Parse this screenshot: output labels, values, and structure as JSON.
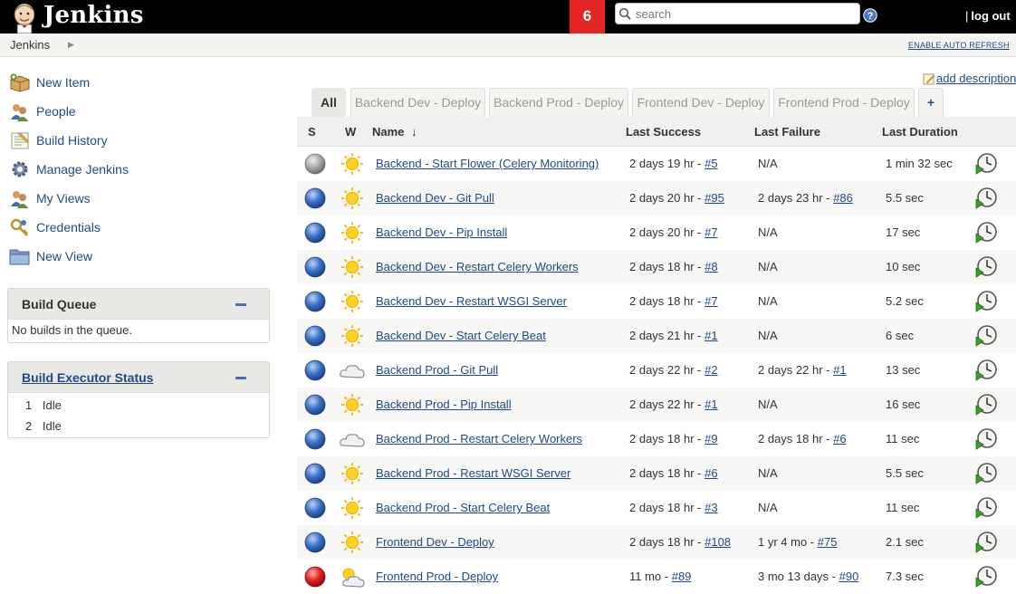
{
  "header": {
    "brand": "Jenkins",
    "notification_count": "6",
    "search_placeholder": "search",
    "logout_separator": "|",
    "logout_label": "log out"
  },
  "breadcrumb": {
    "home": "Jenkins",
    "auto_refresh": "ENABLE AUTO REFRESH"
  },
  "sidebar": {
    "tasks": [
      {
        "label": "New Item",
        "icon": "new-item-icon"
      },
      {
        "label": "People",
        "icon": "people-icon"
      },
      {
        "label": "Build History",
        "icon": "build-history-icon"
      },
      {
        "label": "Manage Jenkins",
        "icon": "gear-icon"
      },
      {
        "label": "My Views",
        "icon": "my-views-icon"
      },
      {
        "label": "Credentials",
        "icon": "credentials-icon"
      },
      {
        "label": "New View",
        "icon": "folder-icon"
      }
    ],
    "build_queue": {
      "title": "Build Queue",
      "empty_text": "No builds in the queue."
    },
    "executors": {
      "title": "Build Executor Status",
      "items": [
        {
          "num": "1",
          "status": "Idle"
        },
        {
          "num": "2",
          "status": "Idle"
        }
      ]
    }
  },
  "main": {
    "add_description": "add description",
    "tabs": [
      "All",
      "Backend Dev - Deploy",
      "Backend Prod - Deploy",
      "Frontend Dev - Deploy",
      "Frontend Prod - Deploy",
      "+"
    ],
    "columns": {
      "s": "S",
      "w": "W",
      "name": "Name",
      "sort_arrow": "↓",
      "last_success": "Last Success",
      "last_failure": "Last Failure",
      "last_duration": "Last Duration"
    },
    "jobs": [
      {
        "name": "Backend - Start Flower (Celery Monitoring)",
        "status": "grey",
        "weather": "sunny",
        "success_text": "2 days 19 hr - ",
        "success_build": "#5",
        "failure_text": "N/A",
        "failure_build": "",
        "duration": "1 min 32 sec"
      },
      {
        "name": "Backend Dev - Git Pull",
        "status": "blue",
        "weather": "sunny",
        "success_text": "2 days 20 hr - ",
        "success_build": "#95",
        "failure_text": "2 days 23 hr - ",
        "failure_build": "#86",
        "duration": "5.5 sec"
      },
      {
        "name": "Backend Dev - Pip Install",
        "status": "blue",
        "weather": "sunny",
        "success_text": "2 days 20 hr - ",
        "success_build": "#7",
        "failure_text": "N/A",
        "failure_build": "",
        "duration": "17 sec"
      },
      {
        "name": "Backend Dev - Restart Celery Workers",
        "status": "blue",
        "weather": "sunny",
        "success_text": "2 days 18 hr - ",
        "success_build": "#8",
        "failure_text": "N/A",
        "failure_build": "",
        "duration": "10 sec"
      },
      {
        "name": "Backend Dev - Restart WSGI Server",
        "status": "blue",
        "weather": "sunny",
        "success_text": "2 days 18 hr - ",
        "success_build": "#7",
        "failure_text": "N/A",
        "failure_build": "",
        "duration": "5.2 sec"
      },
      {
        "name": "Backend Dev - Start Celery Beat",
        "status": "blue",
        "weather": "sunny",
        "success_text": "2 days 21 hr - ",
        "success_build": "#1",
        "failure_text": "N/A",
        "failure_build": "",
        "duration": "6 sec"
      },
      {
        "name": "Backend Prod - Git Pull",
        "status": "blue",
        "weather": "cloudy",
        "success_text": "2 days 22 hr - ",
        "success_build": "#2",
        "failure_text": "2 days 22 hr - ",
        "failure_build": "#1",
        "duration": "13 sec"
      },
      {
        "name": "Backend Prod - Pip Install",
        "status": "blue",
        "weather": "sunny",
        "success_text": "2 days 22 hr - ",
        "success_build": "#1",
        "failure_text": "N/A",
        "failure_build": "",
        "duration": "16 sec"
      },
      {
        "name": "Backend Prod - Restart Celery Workers",
        "status": "blue",
        "weather": "cloudy",
        "success_text": "2 days 18 hr - ",
        "success_build": "#9",
        "failure_text": "2 days 18 hr - ",
        "failure_build": "#6",
        "duration": "11 sec"
      },
      {
        "name": "Backend Prod - Restart WSGI Server",
        "status": "blue",
        "weather": "sunny",
        "success_text": "2 days 18 hr - ",
        "success_build": "#6",
        "failure_text": "N/A",
        "failure_build": "",
        "duration": "5.5 sec"
      },
      {
        "name": "Backend Prod - Start Celery Beat",
        "status": "blue",
        "weather": "sunny",
        "success_text": "2 days 18 hr - ",
        "success_build": "#3",
        "failure_text": "N/A",
        "failure_build": "",
        "duration": "11 sec"
      },
      {
        "name": "Frontend Dev - Deploy",
        "status": "blue",
        "weather": "sunny",
        "success_text": "2 days 18 hr - ",
        "success_build": "#108",
        "failure_text": "1 yr 4 mo - ",
        "failure_build": "#75",
        "duration": "2.1 sec"
      },
      {
        "name": "Frontend Prod - Deploy",
        "status": "red",
        "weather": "partly-cloudy",
        "success_text": "11 mo - ",
        "success_build": "#89",
        "failure_text": "3 mo 13 days - ",
        "failure_build": "#90",
        "duration": "7.3 sec"
      }
    ]
  },
  "colors": {
    "header_bg": "#000000",
    "notification_bg": "#e42525",
    "link": "#204a87",
    "status_blue": "#3a6fc4",
    "status_red": "#e02020",
    "status_grey": "#a0a0a0"
  }
}
